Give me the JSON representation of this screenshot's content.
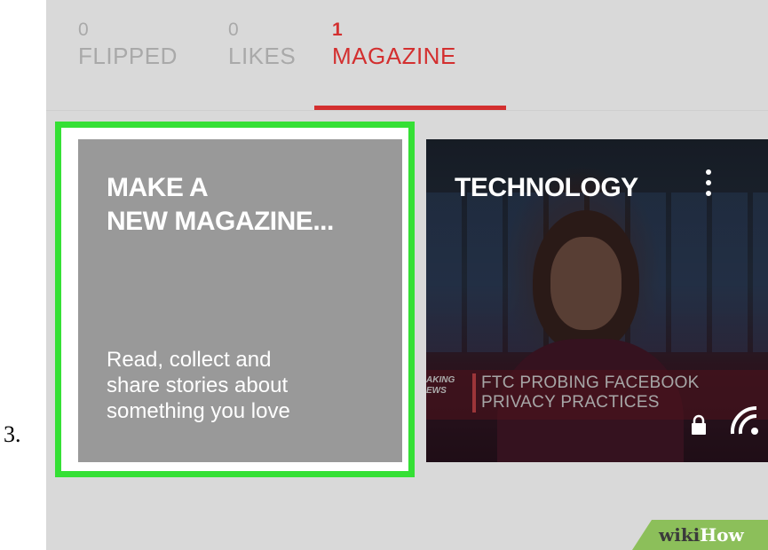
{
  "step": {
    "number": "3."
  },
  "tabs": [
    {
      "count": "0",
      "label": "FLIPPED",
      "active": false
    },
    {
      "count": "0",
      "label": "LIKES",
      "active": false
    },
    {
      "count": "1",
      "label": "MAGAZINE",
      "active": true
    }
  ],
  "cards": {
    "make": {
      "title_line1": "MAKE A",
      "title_line2": "NEW MAGAZINE...",
      "desc_line1": "Read, collect and",
      "desc_line2": "share stories about",
      "desc_line3": "something you love"
    },
    "tech": {
      "title": "TECHNOLOGY",
      "ticker_side_line1": "AKING",
      "ticker_side_line2": "EWS",
      "ticker_line1": "FTC PROBING FACEBOOK",
      "ticker_line2": "PRIVACY PRACTICES",
      "icons": [
        "lock-icon",
        "wifi-icon",
        "more-vert-icon"
      ]
    }
  },
  "watermark": {
    "wiki": "wiki",
    "how": "How"
  },
  "colors": {
    "accent": "#d32f2f",
    "highlight": "#35e035",
    "card_gray": "#999999"
  }
}
